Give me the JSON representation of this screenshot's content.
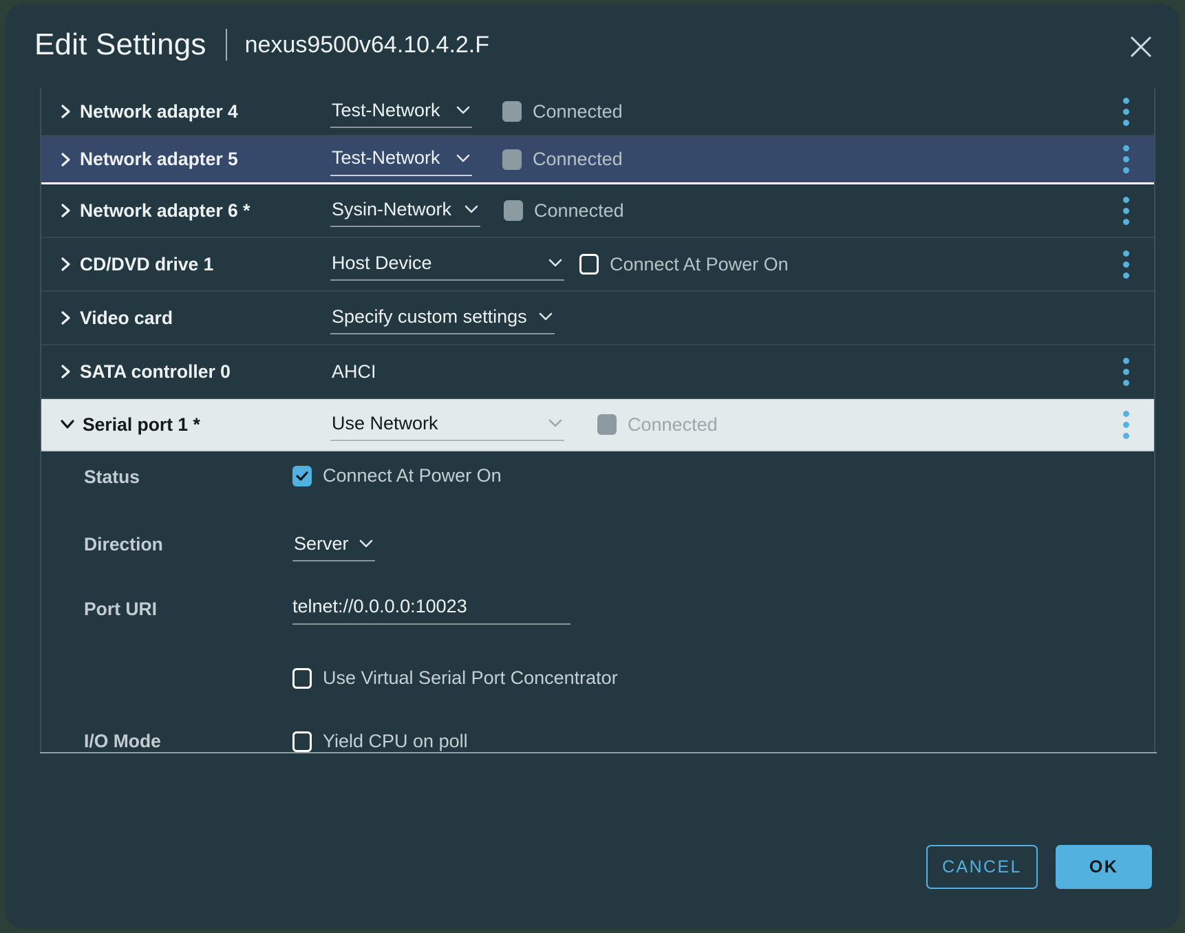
{
  "dialog": {
    "title": "Edit Settings",
    "subtitle": "nexus9500v64.10.4.2.F",
    "close_label": "Close"
  },
  "devices": [
    {
      "label": "Network adapter 4",
      "value": "Test-Network",
      "connected_label": "Connected",
      "state": "normal"
    },
    {
      "label": "Network adapter 5",
      "value": "Test-Network",
      "connected_label": "Connected",
      "state": "selected"
    },
    {
      "label": "Network adapter 6 *",
      "value": "Sysin-Network",
      "connected_label": "Connected",
      "state": "normal"
    },
    {
      "label": "CD/DVD drive 1",
      "value": "Host Device",
      "connected_label": "Connect At Power On",
      "state": "normal"
    },
    {
      "label": "Video card",
      "value": "Specify custom settings",
      "state": "normal"
    },
    {
      "label": "SATA controller 0",
      "value": "AHCI",
      "state": "normal"
    },
    {
      "label": "Serial port 1 *",
      "value": "Use Network",
      "connected_label": "Connected",
      "state": "expanded"
    }
  ],
  "serial_port_detail": {
    "status_label": "Status",
    "status_checkbox_label": "Connect At Power On",
    "direction_label": "Direction",
    "direction_value": "Server",
    "port_uri_label": "Port URI",
    "port_uri_value": "telnet://0.0.0.0:10023",
    "vspc_label": "Use Virtual Serial Port Concentrator",
    "io_mode_label": "I/O Mode",
    "io_mode_checkbox_label": "Yield CPU on poll"
  },
  "footer": {
    "cancel_label": "CANCEL",
    "ok_label": "OK"
  },
  "colors": {
    "dialog_bg": "#233841",
    "selected_row_bg": "#36496a",
    "expanded_row_bg": "#e3eaec",
    "accent": "#53b1e0",
    "kebab_dot": "#57b3dd"
  }
}
